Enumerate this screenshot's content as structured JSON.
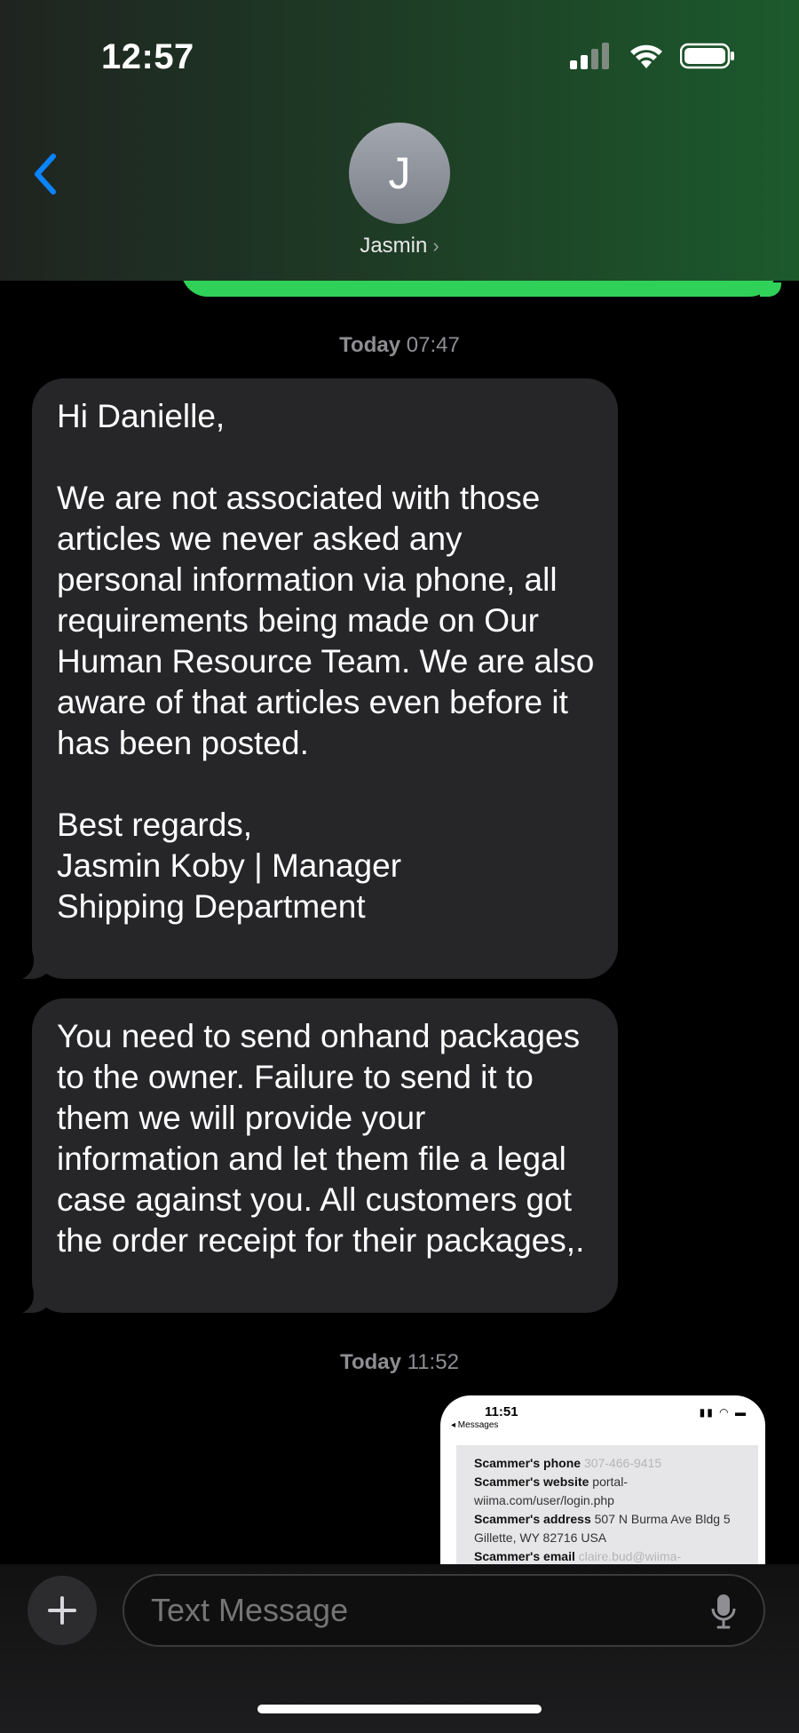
{
  "status_bar": {
    "time": "12:57"
  },
  "header": {
    "avatar_initial": "J",
    "contact_name": "Jasmin"
  },
  "timestamps": [
    {
      "day": "Today",
      "time": "07:47"
    },
    {
      "day": "Today",
      "time": "11:52"
    }
  ],
  "messages": [
    {
      "text": "Hi Danielle,\n\nWe are not associated with those articles we never asked any personal information via phone, all requirements being made on Our Human Resource Team. We are also aware of that articles even before it has been posted.\n\nBest regards,\nJasmin Koby | Manager\nShipping Department"
    },
    {
      "text": "You need to send onhand packages to the owner. Failure to send it to them we will provide your information and let them file a legal case against you. All customers got the order receipt for their packages,."
    }
  ],
  "attachment": {
    "time": "11:51",
    "back_label": "◂ Messages",
    "phone_label": "Scammer's phone",
    "phone_value": "307-466-9415",
    "website_label": "Scammer's website",
    "website_value": "portal-wiima.com/user/login.php",
    "address_label": "Scammer's address",
    "address_value": "507 N Burma Ave Bldg 5 Gillette, WY 82716 USA",
    "email_label": "Scammer's email",
    "email_value": "claire.bud@wiima-"
  },
  "composer": {
    "placeholder": "Text Message"
  },
  "colors": {
    "sent_bubble": "#30d158",
    "received_bubble": "#262628",
    "accent": "#0a84ff"
  }
}
